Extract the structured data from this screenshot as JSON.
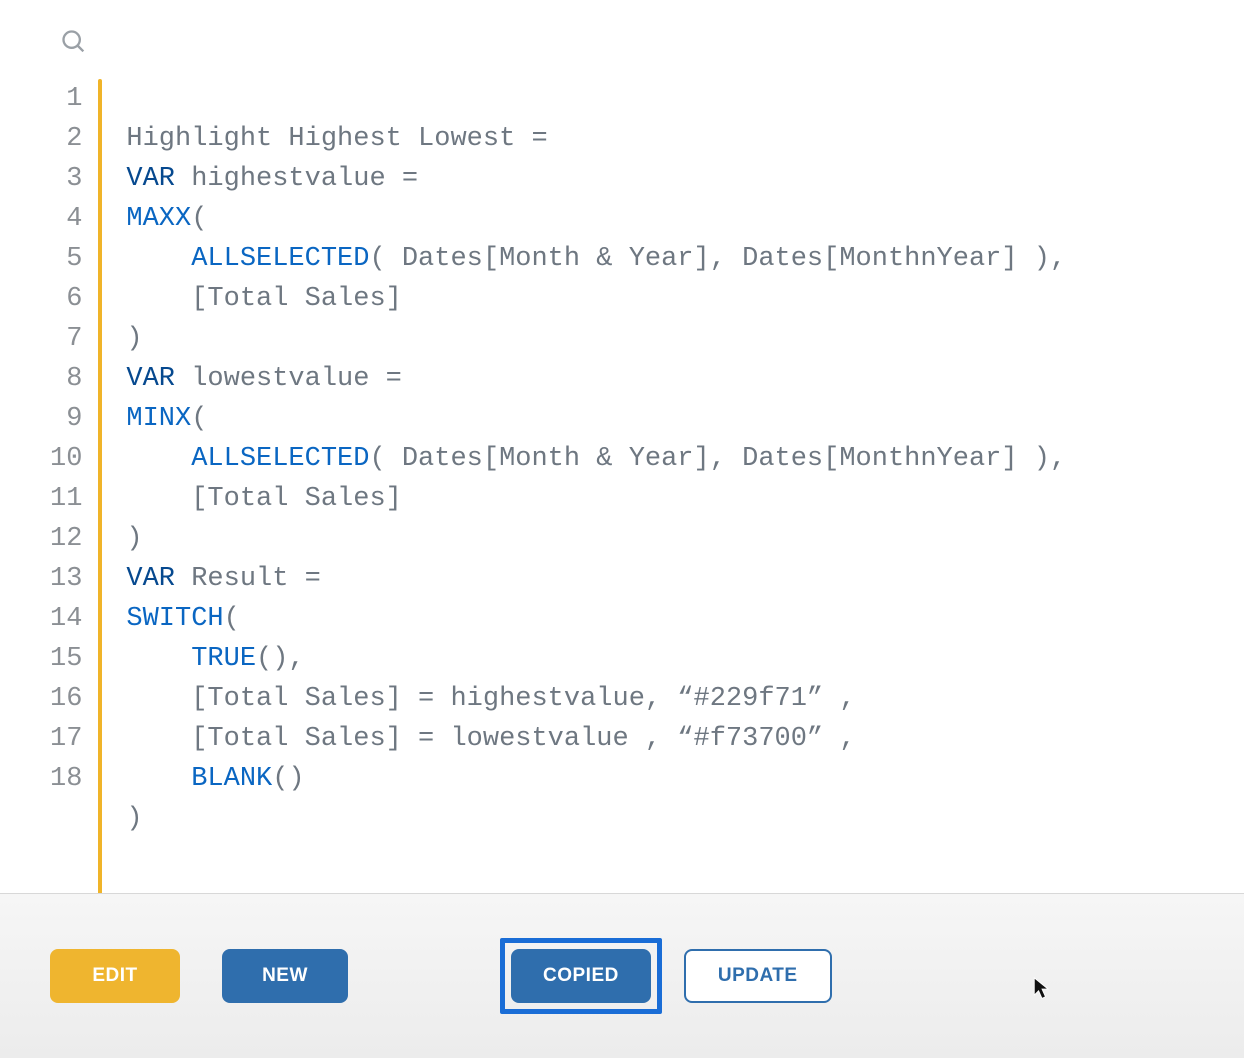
{
  "code": {
    "lines": [
      "1",
      "2",
      "3",
      "4",
      "5",
      "6",
      "7",
      "8",
      "9",
      "10",
      "11",
      "12",
      "13",
      "14",
      "15",
      "16",
      "17",
      "18"
    ],
    "t": {
      "measure_name": "Highlight Highest Lowest",
      "eq": " =",
      "var": "VAR",
      "highestvalue": " highestvalue =",
      "maxx": "MAXX",
      "open": "(",
      "close": ")",
      "indent1": "    ",
      "allselected": "ALLSELECTED",
      "allsel_args": "( Dates[Month & Year], Dates[MonthnYear] ),",
      "total_sales": "[Total Sales]",
      "lowestvalue": " lowestvalue =",
      "minx": "MINX",
      "result": " Result =",
      "switch": "SWITCH",
      "true": "TRUE",
      "true_after": "(),",
      "line15_after": " = highestvalue, “#229f71” ,",
      "line16_after": " = lowestvalue , “#f73700” ,",
      "blank": "BLANK",
      "blank_after": "()"
    }
  },
  "buttons": {
    "edit": "EDIT",
    "new": "NEW",
    "copied": "COPIED",
    "update": "UPDATE"
  }
}
